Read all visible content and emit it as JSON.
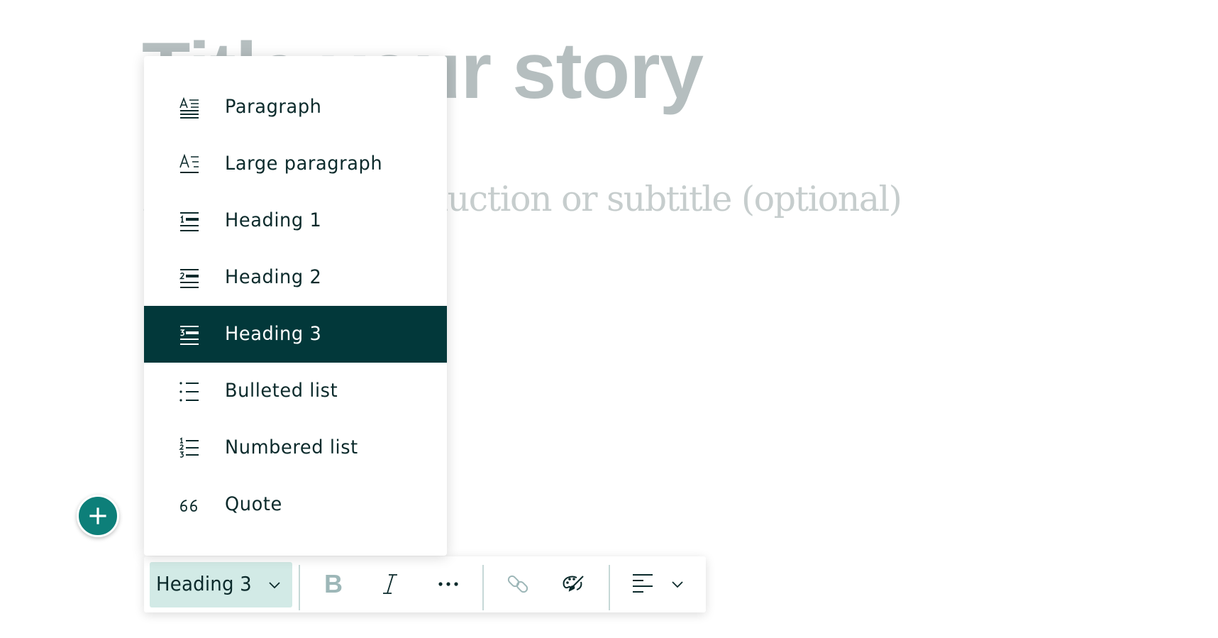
{
  "story": {
    "title_placeholder": "Title your story",
    "subtitle_placeholder": "Add a short introduction or subtitle (optional)"
  },
  "block_menu": {
    "selected_index": 4,
    "items": [
      {
        "label": "Paragraph",
        "icon": "paragraph-icon"
      },
      {
        "label": "Large paragraph",
        "icon": "large-paragraph-icon"
      },
      {
        "label": "Heading 1",
        "icon": "heading-1-icon"
      },
      {
        "label": "Heading 2",
        "icon": "heading-2-icon"
      },
      {
        "label": "Heading 3",
        "icon": "heading-3-icon"
      },
      {
        "label": "Bulleted list",
        "icon": "bulleted-list-icon"
      },
      {
        "label": "Numbered list",
        "icon": "numbered-list-icon"
      },
      {
        "label": "Quote",
        "icon": "quote-icon"
      }
    ]
  },
  "toolbar": {
    "block_type_value": "Heading 3",
    "bold_label": "B",
    "buttons": [
      "bold",
      "italic",
      "more",
      "link",
      "style",
      "alignment"
    ]
  },
  "add_block": {
    "icon": "plus-icon"
  },
  "colors": {
    "accent": "#0D7F79",
    "selected_bg": "#02383A",
    "dropdown_bg": "#D2EAE6",
    "text": "#0B2A2B",
    "placeholder": "#B5BEBF",
    "disabled_icon": "#9DB7B8"
  }
}
